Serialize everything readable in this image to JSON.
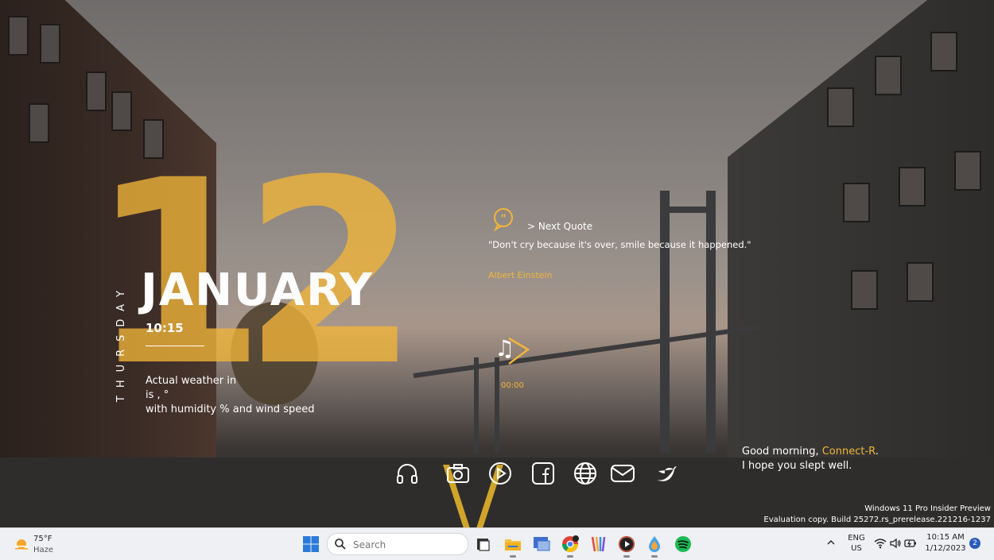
{
  "date_widget": {
    "day_number": "12",
    "weekday": "THURSDAY",
    "month": "JANUARY",
    "time": "10:15"
  },
  "weather_widget": {
    "line1": "Actual weather in",
    "line2": "is , °",
    "line3": "with humidity  % and wind speed"
  },
  "quote_widget": {
    "next_label": "> Next Quote",
    "text": "\"Don't cry because it's over, smile because it happened.\"",
    "author": "Albert Einstein"
  },
  "music_widget": {
    "time": "00:00"
  },
  "greeting": {
    "prefix": "Good morning, ",
    "name": "Connect-R",
    "suffix": ".",
    "line2": "I hope you slept well."
  },
  "dock": [
    {
      "icon": "headphones-icon"
    },
    {
      "icon": "camera-icon"
    },
    {
      "icon": "play-icon"
    },
    {
      "icon": "facebook-icon"
    },
    {
      "icon": "globe-icon"
    },
    {
      "icon": "mail-icon"
    },
    {
      "icon": "twitter-icon"
    }
  ],
  "watermark": {
    "line1": "Windows 11 Pro Insider Preview",
    "line2": "Evaluation copy. Build 25272.rs_prerelease.221216-1237"
  },
  "taskbar": {
    "weather_temp": "75°F",
    "weather_cond": "Haze",
    "search_placeholder": "Search",
    "apps": [
      "task-view-icon",
      "file-explorer-icon",
      "remote-desktop-icon",
      "chrome-icon",
      "stripe-app-icon",
      "media-player-icon",
      "water-drop-icon",
      "spotify-icon"
    ],
    "lang1": "ENG",
    "lang2": "US",
    "time": "10:15 AM",
    "date": "1/12/2023",
    "notifications": "2"
  },
  "colors": {
    "accent": "#f2b53a",
    "taskbar_bg": "#eef0f4",
    "text_white": "#ffffff"
  }
}
